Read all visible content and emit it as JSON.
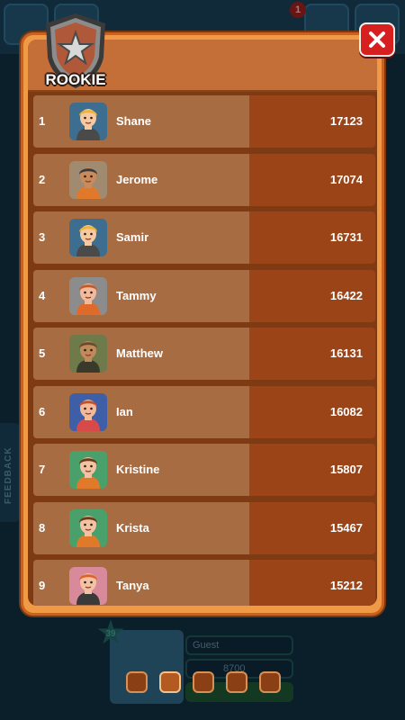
{
  "rank_badge": {
    "label": "ROOKIE",
    "icon": "shield-star-icon"
  },
  "close_button": {
    "icon": "close-icon",
    "glyph": "✕"
  },
  "background": {
    "notification_count": "1",
    "feedback_label": "FEEDBACK",
    "player_level": "39",
    "player_name": "Guest",
    "player_coins": "8700"
  },
  "leaderboard": [
    {
      "rank": "1",
      "name": "Shane",
      "score": "17123",
      "avatar": {
        "skin": "#f7c9a0",
        "hair": "#f2b233",
        "shirt": "#4a4a4a",
        "bg": "#3d6e8f"
      }
    },
    {
      "rank": "2",
      "name": "Jerome",
      "score": "17074",
      "avatar": {
        "skin": "#c98a5c",
        "hair": "#3a3a3a",
        "shirt": "#e07a2a",
        "bg": "#a08a70"
      }
    },
    {
      "rank": "3",
      "name": "Samir",
      "score": "16731",
      "avatar": {
        "skin": "#f7c9a0",
        "hair": "#f2b233",
        "shirt": "#4a4a4a",
        "bg": "#3d6e8f"
      }
    },
    {
      "rank": "4",
      "name": "Tammy",
      "score": "16422",
      "avatar": {
        "skin": "#f2b99a",
        "hair": "#c45a2a",
        "shirt": "#e06a2a",
        "bg": "#8c8c8c"
      }
    },
    {
      "rank": "5",
      "name": "Matthew",
      "score": "16131",
      "avatar": {
        "skin": "#c08a5a",
        "hair": "#6a4a2a",
        "shirt": "#3a3a2a",
        "bg": "#6e7a4a"
      }
    },
    {
      "rank": "6",
      "name": "Ian",
      "score": "16082",
      "avatar": {
        "skin": "#f2b99a",
        "hair": "#c4502a",
        "shirt": "#d84a4a",
        "bg": "#3e5fa8"
      }
    },
    {
      "rank": "7",
      "name": "Kristine",
      "score": "15807",
      "avatar": {
        "skin": "#f2c2a2",
        "hair": "#6a3a1a",
        "shirt": "#e07a2a",
        "bg": "#4aa06a"
      }
    },
    {
      "rank": "8",
      "name": "Krista",
      "score": "15467",
      "avatar": {
        "skin": "#f2c2a2",
        "hair": "#6a3a1a",
        "shirt": "#e07a2a",
        "bg": "#4aa06a"
      }
    },
    {
      "rank": "9",
      "name": "Tanya",
      "score": "15212",
      "avatar": {
        "skin": "#f2c2a2",
        "hair": "#e0602a",
        "shirt": "#3a3a3a",
        "bg": "#d88a9a"
      }
    }
  ],
  "pagination": {
    "pages": 5,
    "current": 2
  },
  "colors": {
    "panel_orange": "#f09a45",
    "row_left": "#a86c42",
    "row_right": "#9a4418",
    "close_red": "#d81f1f"
  }
}
